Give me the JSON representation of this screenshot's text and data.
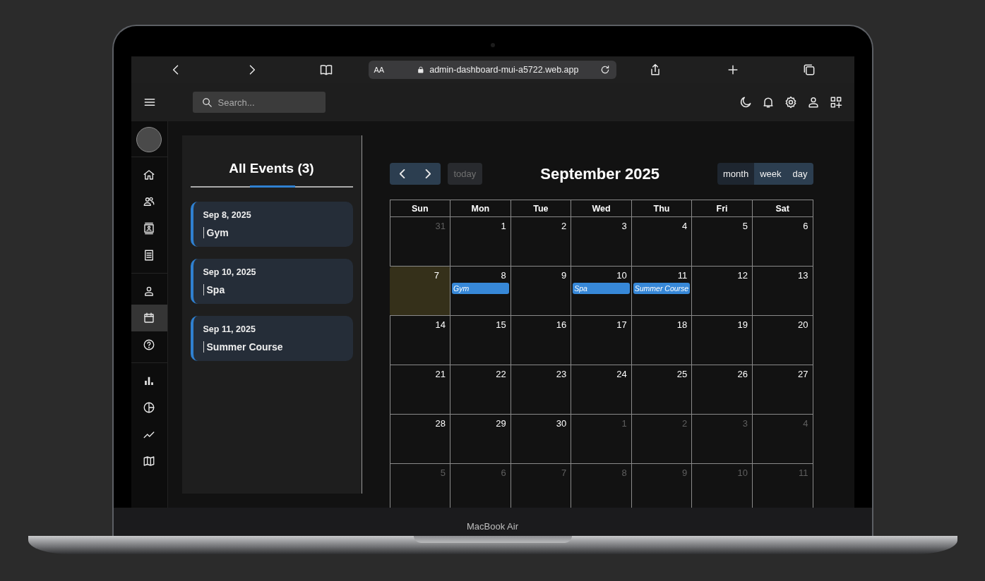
{
  "device": {
    "label": "MacBook Air"
  },
  "browser": {
    "text_size_button": "AA",
    "url": "admin-dashboard-mui-a5722.web.app"
  },
  "app_bar": {
    "search": {
      "placeholder": "Search..."
    }
  },
  "sidebar": {
    "groups": [
      {
        "items": [
          {
            "kind": "home",
            "selected": false
          },
          {
            "kind": "team",
            "selected": false
          },
          {
            "kind": "contacts",
            "selected": false
          },
          {
            "kind": "invoices",
            "selected": false
          }
        ]
      },
      {
        "items": [
          {
            "kind": "profile",
            "selected": false
          },
          {
            "kind": "calendar",
            "selected": true
          },
          {
            "kind": "help",
            "selected": false
          }
        ]
      },
      {
        "items": [
          {
            "kind": "bar",
            "selected": false
          },
          {
            "kind": "pie",
            "selected": false
          },
          {
            "kind": "line",
            "selected": false
          },
          {
            "kind": "map",
            "selected": false
          }
        ]
      }
    ]
  },
  "events_panel": {
    "title": "All Events (3)",
    "events": [
      {
        "date": "Sep 8, 2025",
        "title": "Gym"
      },
      {
        "date": "Sep 10, 2025",
        "title": "Spa"
      },
      {
        "date": "Sep 11, 2025",
        "title": "Summer Course"
      }
    ]
  },
  "calendar": {
    "title": "September 2025",
    "today_button": {
      "label": "today",
      "disabled": true
    },
    "views": [
      {
        "label": "month",
        "selected": true
      },
      {
        "label": "week",
        "selected": false
      },
      {
        "label": "day",
        "selected": false
      }
    ],
    "weekdays": [
      "Sun",
      "Mon",
      "Tue",
      "Wed",
      "Thu",
      "Fri",
      "Sat"
    ],
    "weeks": [
      [
        {
          "day": "31",
          "other_month": true,
          "today": false
        },
        {
          "day": "1",
          "other_month": false,
          "today": false
        },
        {
          "day": "2",
          "other_month": false,
          "today": false
        },
        {
          "day": "3",
          "other_month": false,
          "today": false
        },
        {
          "day": "4",
          "other_month": false,
          "today": false
        },
        {
          "day": "5",
          "other_month": false,
          "today": false
        },
        {
          "day": "6",
          "other_month": false,
          "today": false
        }
      ],
      [
        {
          "day": "7",
          "other_month": false,
          "today": true
        },
        {
          "day": "8",
          "other_month": false,
          "today": false,
          "events": [
            "Gym"
          ]
        },
        {
          "day": "9",
          "other_month": false,
          "today": false
        },
        {
          "day": "10",
          "other_month": false,
          "today": false,
          "events": [
            "Spa"
          ]
        },
        {
          "day": "11",
          "other_month": false,
          "today": false,
          "events": [
            "Summer Course"
          ]
        },
        {
          "day": "12",
          "other_month": false,
          "today": false
        },
        {
          "day": "13",
          "other_month": false,
          "today": false
        }
      ],
      [
        {
          "day": "14",
          "other_month": false,
          "today": false
        },
        {
          "day": "15",
          "other_month": false,
          "today": false
        },
        {
          "day": "16",
          "other_month": false,
          "today": false
        },
        {
          "day": "17",
          "other_month": false,
          "today": false
        },
        {
          "day": "18",
          "other_month": false,
          "today": false
        },
        {
          "day": "19",
          "other_month": false,
          "today": false
        },
        {
          "day": "20",
          "other_month": false,
          "today": false
        }
      ],
      [
        {
          "day": "21",
          "other_month": false,
          "today": false
        },
        {
          "day": "22",
          "other_month": false,
          "today": false
        },
        {
          "day": "23",
          "other_month": false,
          "today": false
        },
        {
          "day": "24",
          "other_month": false,
          "today": false
        },
        {
          "day": "25",
          "other_month": false,
          "today": false
        },
        {
          "day": "26",
          "other_month": false,
          "today": false
        },
        {
          "day": "27",
          "other_month": false,
          "today": false
        }
      ],
      [
        {
          "day": "28",
          "other_month": false,
          "today": false
        },
        {
          "day": "29",
          "other_month": false,
          "today": false
        },
        {
          "day": "30",
          "other_month": false,
          "today": false
        },
        {
          "day": "1",
          "other_month": true,
          "today": false
        },
        {
          "day": "2",
          "other_month": true,
          "today": false
        },
        {
          "day": "3",
          "other_month": true,
          "today": false
        },
        {
          "day": "4",
          "other_month": true,
          "today": false
        }
      ],
      [
        {
          "day": "5",
          "other_month": true,
          "today": false
        },
        {
          "day": "6",
          "other_month": true,
          "today": false
        },
        {
          "day": "7",
          "other_month": true,
          "today": false
        },
        {
          "day": "8",
          "other_month": true,
          "today": false
        },
        {
          "day": "9",
          "other_month": true,
          "today": false
        },
        {
          "day": "10",
          "other_month": true,
          "today": false
        },
        {
          "day": "11",
          "other_month": true,
          "today": false
        }
      ]
    ]
  }
}
